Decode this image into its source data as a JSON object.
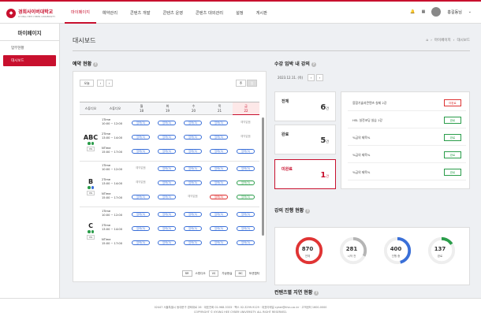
{
  "header": {
    "logo_name": "경희사이버대학교",
    "logo_sub": "KYUNG HEE CYBER UNIVERSITY",
    "menu": [
      {
        "label": "마이페이지"
      },
      {
        "label": "예약관리"
      },
      {
        "label": "콘텐츠 개발"
      },
      {
        "label": "콘텐츠 운영"
      },
      {
        "label": "콘텐츠 대외관리"
      },
      {
        "label": "설정"
      },
      {
        "label": "게시판"
      }
    ],
    "user_name": "홍길동님"
  },
  "sidebar": {
    "title": "마이페이지",
    "items": [
      {
        "label": "업무현황"
      },
      {
        "label": "대시보드"
      }
    ]
  },
  "page": {
    "title": "대시보드",
    "breadcrumb": [
      "마이페이지",
      "대시보드"
    ]
  },
  "reservation": {
    "title": "예약 현황",
    "today_btn": "오늘",
    "view_week": "주",
    "view_day": "일",
    "headers": {
      "studio": "스튜디오",
      "studio2": "스튜디오"
    },
    "days": [
      {
        "name": "월",
        "date": "18"
      },
      {
        "name": "화",
        "date": "19"
      },
      {
        "name": "수",
        "date": "20"
      },
      {
        "name": "목",
        "date": "21"
      },
      {
        "name": "금",
        "date": "22"
      }
    ],
    "studios": [
      {
        "name": "ABC",
        "vs": "VS"
      },
      {
        "name": "B",
        "vs": "VS"
      },
      {
        "name": "C",
        "vs": "VS"
      }
    ],
    "times": [
      {
        "label": "1Time",
        "range": "10:00 ~ 12:00"
      },
      {
        "label": "2Time",
        "range": "13:00 ~ 14:00"
      },
      {
        "label": "NTime",
        "range": "15:00 ~ 17:00"
      }
    ],
    "slot_texts": {
      "full": "있어(3)",
      "avail": "예약없음"
    },
    "legend": [
      {
        "code": "RR",
        "text": "스튜디오"
      },
      {
        "code": "VS",
        "text": "가상현실"
      },
      {
        "code": "MC",
        "text": "모션캡처"
      }
    ]
  },
  "expiry": {
    "title": "수강 임박 내 강의",
    "date": "2023.12.11. (목)",
    "cards": [
      {
        "label": "전체",
        "value": "6",
        "unit": "건"
      },
      {
        "label": "완료",
        "value": "5",
        "unit": "건"
      },
      {
        "label": "미완료",
        "value": "1",
        "unit": "건"
      }
    ],
    "list": [
      {
        "text": "융합기술과콘텐츠 실제 2강",
        "status": "미완료"
      },
      {
        "text": "HSL 실전코딩 실습 1강",
        "status": "완료"
      },
      {
        "text": "%금의 제목%",
        "status": "완료"
      },
      {
        "text": "%금의 제목%",
        "status": "완료"
      },
      {
        "text": "%금의 제목%",
        "status": "완료"
      }
    ]
  },
  "progress": {
    "title": "강의 진행 현황",
    "items": [
      {
        "value": "870",
        "label": "전체",
        "color": "#e03434"
      },
      {
        "value": "281",
        "label": "시작 전",
        "color": "#b5b5b5"
      },
      {
        "value": "400",
        "label": "진행 중",
        "color": "#3a6fd8"
      },
      {
        "value": "137",
        "label": "완료",
        "color": "#2a9d4a"
      }
    ]
  },
  "content_status": {
    "title": "컨텐츠별 지연 현황"
  },
  "footer": {
    "line1": "02447 서울특별시 동대문구 경희대로 26 · 대표전화 02-968-3333 · 팩스 02-3299-9129 · 대표이메일 cyber@khcu.ac.kr · 고객센터 1600-0000",
    "line2": "COPYRIGHT © KYUNG HEE CYBER UNIVERSITY. ALL RIGHT RESERVED."
  }
}
